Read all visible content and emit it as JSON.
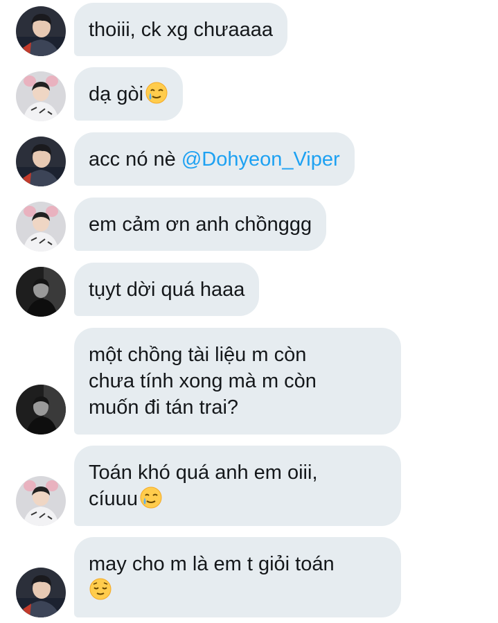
{
  "messages": [
    {
      "avatar": "avatar-a",
      "text": "thoiii, ck xg chưaaaa"
    },
    {
      "avatar": "avatar-b",
      "text": "dạ gòi",
      "emoji": "tearful-smile-emoji"
    },
    {
      "avatar": "avatar-a",
      "text": "acc nó nè ",
      "mention": "@Dohyeon_Viper"
    },
    {
      "avatar": "avatar-b",
      "text": "em cảm ơn anh chồnggg"
    },
    {
      "avatar": "avatar-c",
      "text": "tụyt dời quá haaa"
    },
    {
      "avatar": "avatar-c",
      "text": "một chồng tài liệu m còn\nchưa tính xong mà m còn\nmuốn đi tán trai?"
    },
    {
      "avatar": "avatar-b",
      "text": "Toán khó quá anh em oiii,\ncíuuu",
      "emoji": "tearful-smile-emoji"
    },
    {
      "avatar": "avatar-a",
      "text": "may cho m là em t giỏi toán\n",
      "emoji": "relieved-face-emoji"
    }
  ],
  "colors": {
    "bubble": "#e6ecf0",
    "text": "#14171a",
    "mention": "#1da1f2"
  }
}
